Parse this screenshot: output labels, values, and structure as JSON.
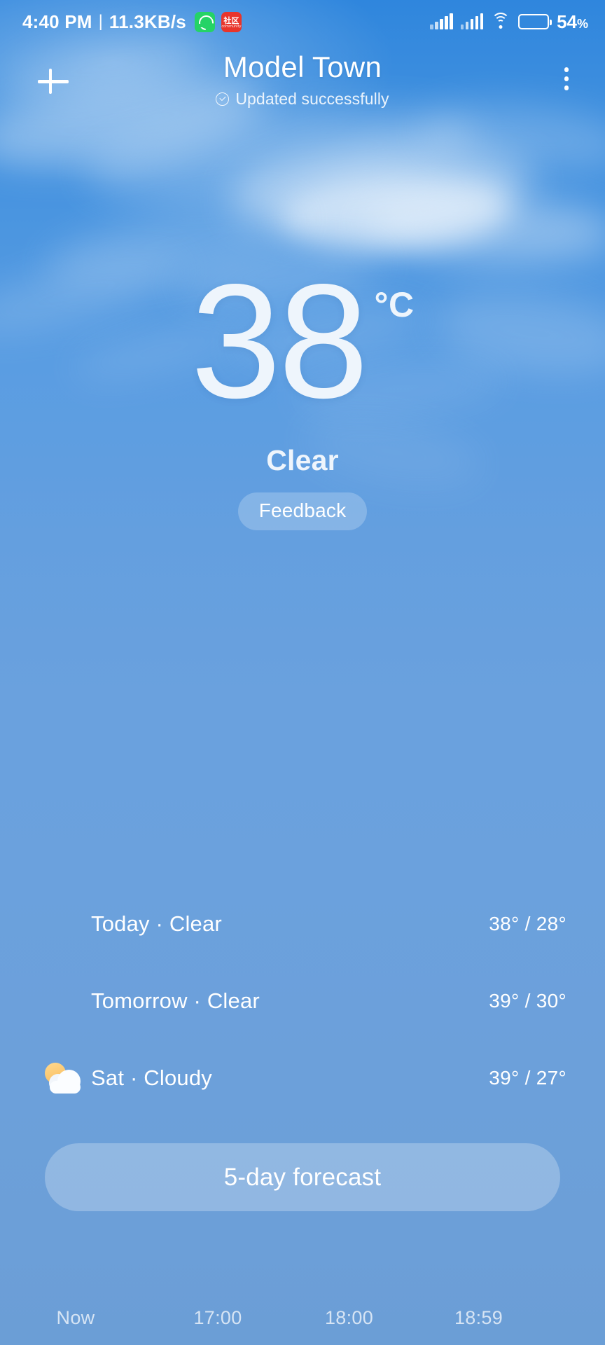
{
  "status_bar": {
    "clock": "4:40 PM",
    "separator": "|",
    "network_speed": "11.3KB/s",
    "app_icons": [
      {
        "name": "whatsapp-icon",
        "label": ""
      },
      {
        "name": "community-app-icon",
        "label": "社区",
        "sublabel": "community"
      }
    ],
    "signal_label": "signal-bars",
    "wifi_label": "wifi-icon",
    "battery_percent": "54",
    "battery_unit": "%",
    "battery_level": 54,
    "battery_color": "#f0a12e"
  },
  "app_bar": {
    "add_label": "+",
    "city": "Model Town",
    "update_status": "Updated successfully",
    "menu_label": "more-options"
  },
  "current": {
    "temperature": "38",
    "unit": "°C",
    "condition": "Clear",
    "feedback_label": "Feedback"
  },
  "daily": {
    "rows": [
      {
        "icon": "sun-icon",
        "label": "Today · Clear",
        "temps": "38° / 28°",
        "high": 38,
        "low": 28
      },
      {
        "icon": "sun-icon",
        "label": "Tomorrow · Clear",
        "temps": "39° / 30°",
        "high": 39,
        "low": 30
      },
      {
        "icon": "sun-behind-cloud-icon",
        "label": "Sat · Cloudy",
        "temps": "39° / 27°",
        "high": 39,
        "low": 27
      }
    ]
  },
  "five_day_button": {
    "label": "5-day forecast"
  },
  "hourly": {
    "times": [
      "Now",
      "17:00",
      "18:00",
      "18:59"
    ]
  },
  "colors": {
    "sky_top": "#2f86dd",
    "sky_bottom": "#6b9ed6",
    "sun_yellow": "#fdc870",
    "text_white": "#ffffff",
    "temp_white": "#eef5fc"
  }
}
